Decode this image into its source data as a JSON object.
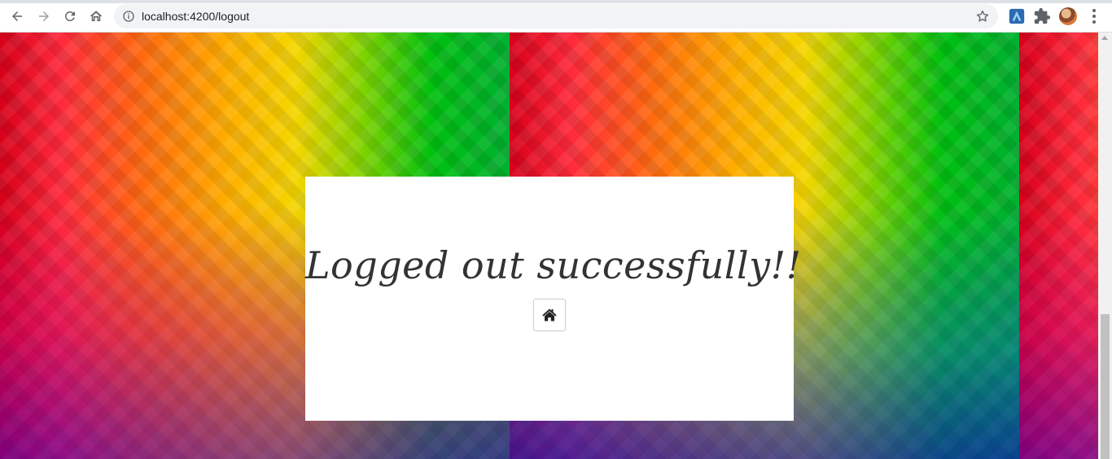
{
  "browser": {
    "url": "localhost:4200/logout",
    "icons": {
      "back": "arrow-left-icon",
      "forward": "arrow-right-icon",
      "reload": "reload-icon",
      "home": "home-icon",
      "info": "info-icon",
      "bookmark": "star-icon",
      "extension1": "extension-logo-icon",
      "extensions": "puzzle-icon",
      "profile": "avatar",
      "menu": "more-vert-icon"
    }
  },
  "page": {
    "message": "Logged out successfully!!",
    "home_button_icon": "home-icon"
  },
  "colors": {
    "card_bg": "#ffffff",
    "message_text": "#333333"
  }
}
